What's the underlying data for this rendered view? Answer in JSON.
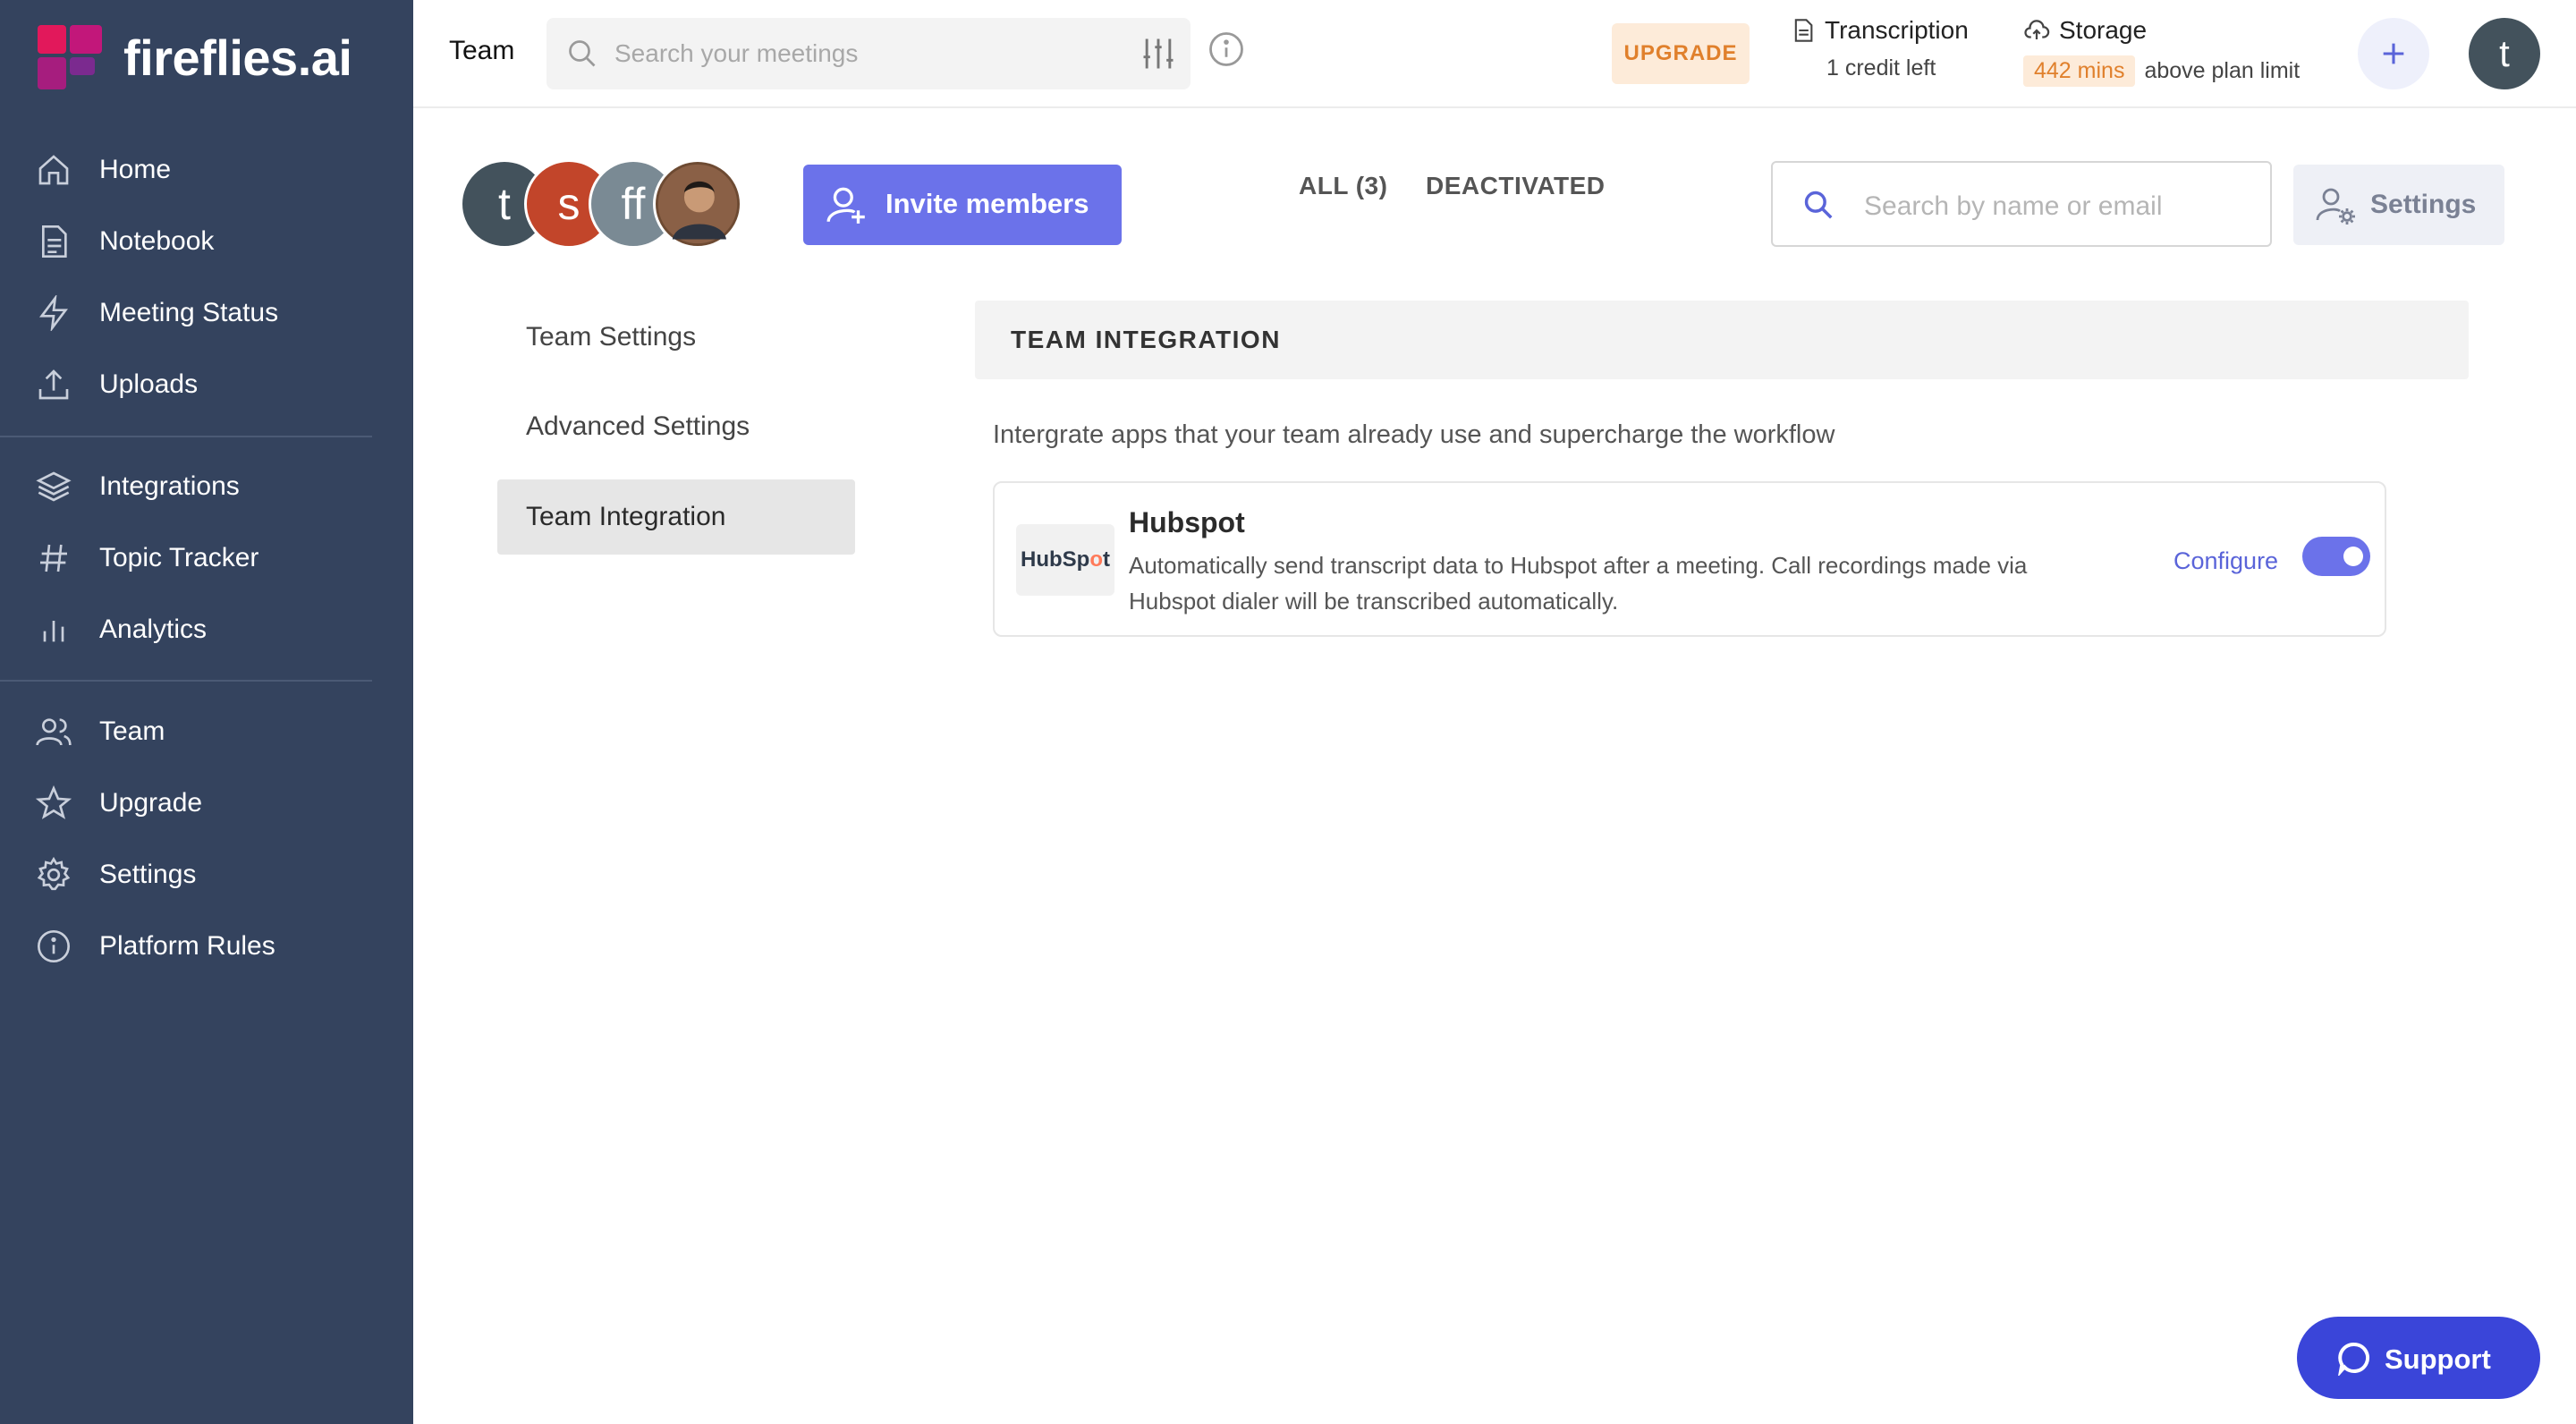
{
  "app": {
    "name": "fireflies.ai",
    "colors": {
      "sidebar": "#34435e",
      "accent": "#6b72ea",
      "support": "#3a45d9",
      "upgrade": "#e0802c"
    }
  },
  "sidebar": {
    "group1": [
      {
        "label": "Home",
        "icon": "home-icon"
      },
      {
        "label": "Notebook",
        "icon": "notebook-icon"
      },
      {
        "label": "Meeting Status",
        "icon": "lightning-icon"
      },
      {
        "label": "Uploads",
        "icon": "upload-icon"
      }
    ],
    "group2": [
      {
        "label": "Integrations",
        "icon": "layers-icon"
      },
      {
        "label": "Topic Tracker",
        "icon": "hash-icon"
      },
      {
        "label": "Analytics",
        "icon": "bar-chart-icon"
      }
    ],
    "group3": [
      {
        "label": "Team",
        "icon": "users-icon"
      },
      {
        "label": "Upgrade",
        "icon": "star-icon"
      },
      {
        "label": "Settings",
        "icon": "gear-icon"
      },
      {
        "label": "Platform Rules",
        "icon": "info-icon"
      }
    ]
  },
  "topbar": {
    "page_title": "Team",
    "search_placeholder": "Search your meetings",
    "upgrade_label": "UPGRADE",
    "transcription": {
      "title": "Transcription",
      "subtitle": "1 credit left"
    },
    "storage": {
      "title": "Storage",
      "badge": "442 mins",
      "note": "above plan limit"
    },
    "user_initial": "t"
  },
  "members": {
    "avatars": [
      {
        "initial": "t",
        "color": "#43525c"
      },
      {
        "initial": "s",
        "color": "#c2452a"
      },
      {
        "initial": "ff",
        "color": "#7a8a94"
      },
      {
        "initial": "",
        "color": "#6d4a32"
      }
    ],
    "invite_label": "Invite members",
    "tabs": [
      {
        "label": "ALL (3)"
      },
      {
        "label": "DEACTIVATED"
      }
    ],
    "search_placeholder": "Search by name or email",
    "settings_label": "Settings"
  },
  "submenu": [
    {
      "label": "Team Settings"
    },
    {
      "label": "Advanced Settings"
    },
    {
      "label": "Team Integration"
    }
  ],
  "integration_panel": {
    "header": "TEAM INTEGRATION",
    "description": "Intergrate apps that your team already use and supercharge the workflow",
    "items": [
      {
        "name": "Hubspot",
        "logo_text_a": "HubSp",
        "logo_text_b": "o",
        "logo_text_c": "t",
        "description": "Automatically send transcript data to Hubspot after a meeting. Call recordings made via Hubspot dialer will be transcribed automatically.",
        "configure_label": "Configure",
        "enabled": true
      }
    ]
  },
  "support_label": "Support"
}
